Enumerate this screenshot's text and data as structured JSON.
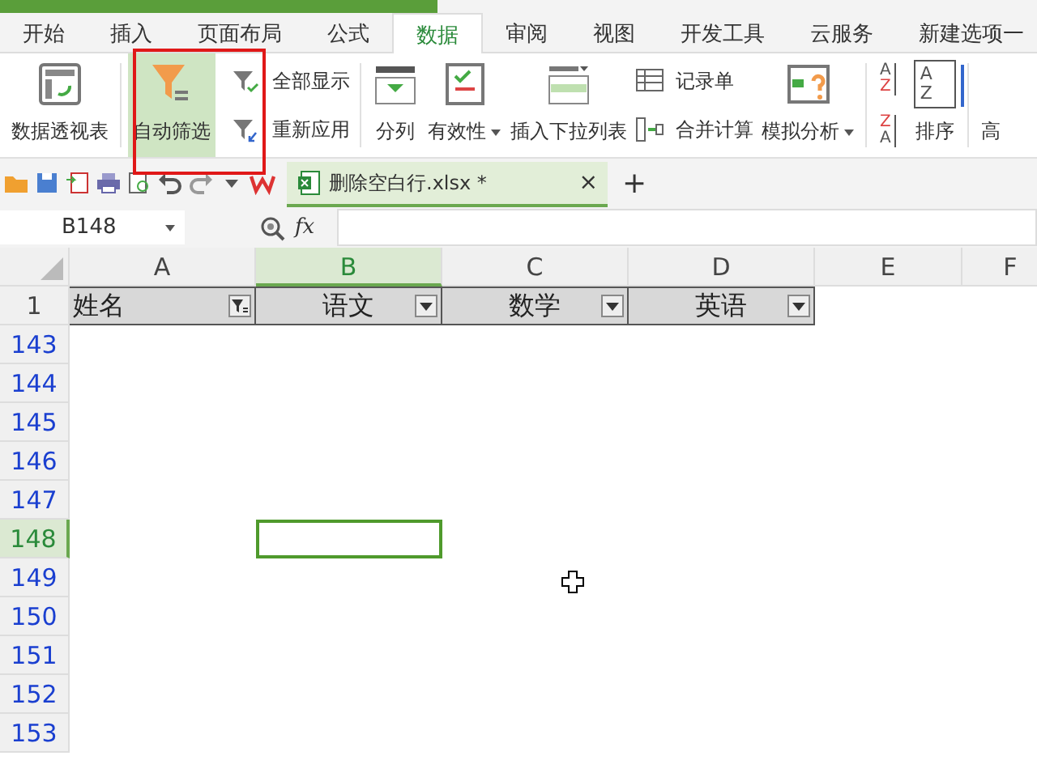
{
  "tabs": [
    {
      "label": "开始",
      "selected": false
    },
    {
      "label": "插入",
      "selected": false
    },
    {
      "label": "页面布局",
      "selected": false
    },
    {
      "label": "公式",
      "selected": false
    },
    {
      "label": "数据",
      "selected": true
    },
    {
      "label": "审阅",
      "selected": false
    },
    {
      "label": "视图",
      "selected": false
    },
    {
      "label": "开发工具",
      "selected": false
    },
    {
      "label": "云服务",
      "selected": false
    },
    {
      "label": "新建选项一",
      "selected": false
    }
  ],
  "ribbon": [
    {
      "kind": "large",
      "label": "数据透视表",
      "dropdown": false,
      "selected": false
    },
    {
      "kind": "sep"
    },
    {
      "kind": "large",
      "label": "自动筛选",
      "dropdown": false,
      "selected": true
    },
    {
      "kind": "stack",
      "entries": [
        {
          "label": "全部显示"
        },
        {
          "label": "重新应用"
        }
      ]
    },
    {
      "kind": "sep"
    },
    {
      "kind": "large",
      "label": "分列",
      "dropdown": false,
      "selected": false
    },
    {
      "kind": "large",
      "label": "有效性",
      "dropdown": true,
      "selected": false
    },
    {
      "kind": "large",
      "label": "插入下拉列表",
      "dropdown": false,
      "selected": false
    },
    {
      "kind": "stack",
      "entries": [
        {
          "label": "记录单"
        },
        {
          "label": "合并计算"
        }
      ]
    },
    {
      "kind": "large",
      "label": "模拟分析",
      "dropdown": true,
      "selected": false
    },
    {
      "kind": "sep"
    },
    {
      "kind": "sorticons",
      "entries": [
        {
          "letters": [
            "A",
            "Z"
          ]
        },
        {
          "letters": [
            "Z",
            "A"
          ]
        }
      ]
    },
    {
      "kind": "sortlarge",
      "letters": [
        "A",
        "Z"
      ],
      "label": "排序"
    },
    {
      "kind": "sep"
    },
    {
      "kind": "large",
      "label": "高",
      "dropdown": false,
      "selected": false
    }
  ],
  "document_tab": {
    "title": "删除空白行.xlsx *",
    "close": "×",
    "new_tab": "+"
  },
  "formula_bar": {
    "cell_reference": "B148",
    "fx": "fx"
  },
  "columns": [
    {
      "label": "A",
      "selected": false
    },
    {
      "label": "B",
      "selected": true
    },
    {
      "label": "C",
      "selected": false
    },
    {
      "label": "D",
      "selected": false
    },
    {
      "label": "E",
      "selected": false
    },
    {
      "label": "F",
      "selected": false
    }
  ],
  "header_row": {
    "number": "1",
    "cells": [
      {
        "text": "姓名",
        "filtered": true
      },
      {
        "text": "语文",
        "filtered": false
      },
      {
        "text": "数学",
        "filtered": false
      },
      {
        "text": "英语",
        "filtered": false
      }
    ]
  },
  "rows": [
    {
      "number": "143",
      "selected": false
    },
    {
      "number": "144",
      "selected": false
    },
    {
      "number": "145",
      "selected": false
    },
    {
      "number": "146",
      "selected": false
    },
    {
      "number": "147",
      "selected": false
    },
    {
      "number": "148",
      "selected": true
    },
    {
      "number": "149",
      "selected": false
    },
    {
      "number": "150",
      "selected": false
    },
    {
      "number": "151",
      "selected": false
    },
    {
      "number": "152",
      "selected": false
    },
    {
      "number": "153",
      "selected": false
    }
  ]
}
